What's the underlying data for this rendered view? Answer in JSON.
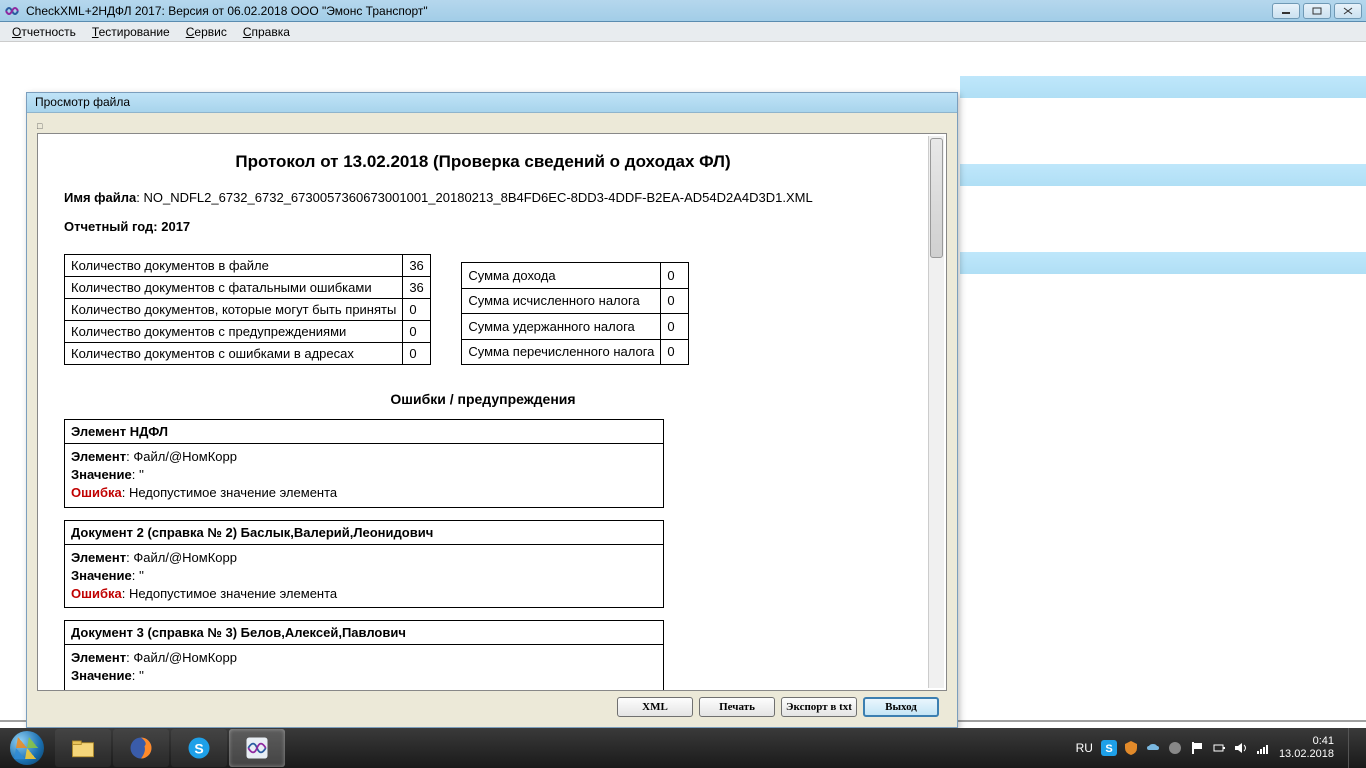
{
  "titlebar": {
    "text": "CheckXML+2НДФЛ 2017:  Версия от 06.02.2018 ООО \"Эмонс Транспорт\""
  },
  "menubar": [
    "Отчетность",
    "Тестирование",
    "Сервис",
    "Справка"
  ],
  "dialog": {
    "title": "Просмотр файла",
    "heading": "Протокол от 13.02.2018 (Проверка сведений о доходах ФЛ)",
    "filename_label": "Имя файла",
    "filename": "NO_NDFL2_6732_6732_6730057360673001001_20180213_8B4FD6EC-8DD3-4DDF-B2EA-AD54D2A4D3D1.XML",
    "year_label": "Отчетный год",
    "year": "2017",
    "left_table": [
      {
        "label": "Количество документов в файле",
        "val": "36"
      },
      {
        "label": "Количество документов с фатальными ошибками",
        "val": "36"
      },
      {
        "label": "Количество документов, которые могут быть приняты",
        "val": "0"
      },
      {
        "label": "Количество документов с предупреждениями",
        "val": "0"
      },
      {
        "label": "Количество документов с ошибками в адресах",
        "val": "0"
      }
    ],
    "right_table": [
      {
        "label": "Сумма дохода",
        "val": "0"
      },
      {
        "label": "Сумма исчисленного налога",
        "val": "0"
      },
      {
        "label": "Сумма удержанного налога",
        "val": "0"
      },
      {
        "label": "Сумма перечисленного налога",
        "val": "0"
      }
    ],
    "errors_title": "Ошибки / предупреждения",
    "labels": {
      "element": "Элемент",
      "value": "Значение",
      "error": "Ошибка"
    },
    "errors": [
      {
        "head": "Элемент НДФЛ",
        "element": "Файл/@НомКорр",
        "value": "''",
        "error": "Недопустимое значение элемента",
        "show_error": true
      },
      {
        "head": "Документ 2 (справка № 2) Баслык,Валерий,Леонидович",
        "element": "Файл/@НомКорр",
        "value": "''",
        "error": "Недопустимое значение элемента",
        "show_error": true
      },
      {
        "head": "Документ 3 (справка № 3) Белов,Алексей,Павлович",
        "element": "Файл/@НомКорр",
        "value": "''",
        "error": "",
        "show_error": false
      }
    ],
    "buttons": {
      "xml": "XML",
      "print": "Печать",
      "export": "Экспорт в txt",
      "exit": "Выход"
    }
  },
  "taskbar": {
    "items": [
      "explorer",
      "firefox",
      "skype",
      "checkxml"
    ],
    "tray": {
      "lang": "RU",
      "time": "0:41",
      "date": "13.02.2018"
    }
  }
}
